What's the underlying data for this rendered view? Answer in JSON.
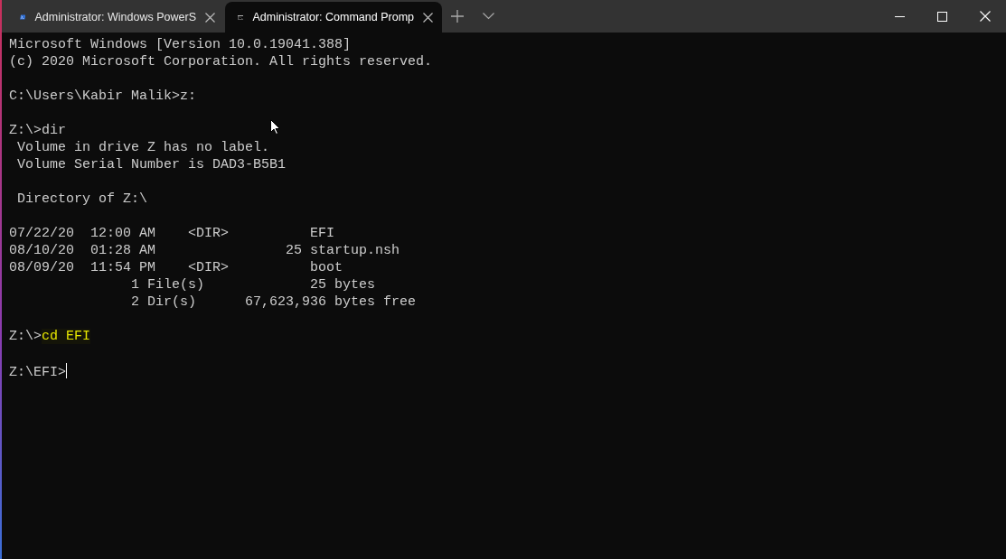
{
  "tabs": [
    {
      "kind": "powershell",
      "title": "Administrator: Windows PowerS",
      "selected": false
    },
    {
      "kind": "cmd",
      "title": "Administrator: Command Promp",
      "selected": true
    }
  ],
  "terminal": {
    "lines": [
      {
        "kind": "text",
        "text": "Microsoft Windows [Version 10.0.19041.388]"
      },
      {
        "kind": "text",
        "text": "(c) 2020 Microsoft Corporation. All rights reserved."
      },
      {
        "kind": "blank"
      },
      {
        "kind": "text",
        "text": "C:\\Users\\Kabir Malik>z:"
      },
      {
        "kind": "blank"
      },
      {
        "kind": "text",
        "text": "Z:\\>dir"
      },
      {
        "kind": "text",
        "text": " Volume in drive Z has no label."
      },
      {
        "kind": "text",
        "text": " Volume Serial Number is DAD3-B5B1"
      },
      {
        "kind": "blank"
      },
      {
        "kind": "text",
        "text": " Directory of Z:\\"
      },
      {
        "kind": "blank"
      },
      {
        "kind": "text",
        "text": "07/22/20  12:00 AM    <DIR>          EFI"
      },
      {
        "kind": "text",
        "text": "08/10/20  01:28 AM                25 startup.nsh"
      },
      {
        "kind": "text",
        "text": "08/09/20  11:54 PM    <DIR>          boot"
      },
      {
        "kind": "text",
        "text": "               1 File(s)             25 bytes"
      },
      {
        "kind": "text",
        "text": "               2 Dir(s)      67,623,936 bytes free"
      },
      {
        "kind": "blank"
      },
      {
        "kind": "command",
        "prompt": "Z:\\>",
        "command": "cd EFI"
      },
      {
        "kind": "blank"
      },
      {
        "kind": "cursor",
        "prompt": "Z:\\EFI>"
      }
    ]
  }
}
